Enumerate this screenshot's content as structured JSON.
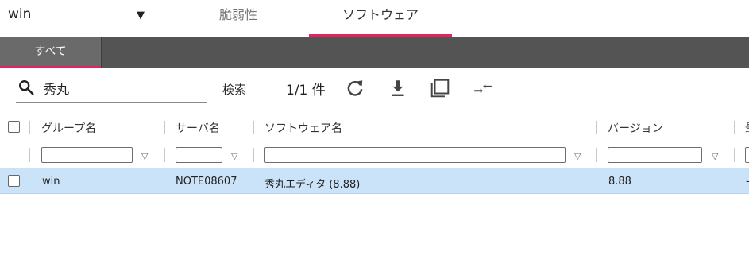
{
  "header": {
    "group_select": {
      "value": "win",
      "caret_icon": "caret-down-icon"
    },
    "tabs": [
      {
        "label": "脆弱性",
        "active": false
      },
      {
        "label": "ソフトウェア",
        "active": true
      }
    ],
    "accent_color": "#e0245e"
  },
  "subnav": {
    "tab_label": "すべて",
    "bar_color": "#545454"
  },
  "toolbar": {
    "search_value": "秀丸",
    "search_button_label": "検索",
    "result_count": "1/1 件",
    "icons": [
      "refresh-icon",
      "download-icon",
      "window-icon",
      "column-adjust-icon"
    ]
  },
  "grid": {
    "columns": [
      "グループ名",
      "サーバ名",
      "ソフトウェア名",
      "バージョン",
      "最"
    ],
    "rows": [
      {
        "group": "win",
        "server": "NOTE08607",
        "software": "秀丸エディタ (8.88)",
        "version": "8.88",
        "extra": "-"
      }
    ],
    "selected_row_color": "#cbe3f9"
  }
}
